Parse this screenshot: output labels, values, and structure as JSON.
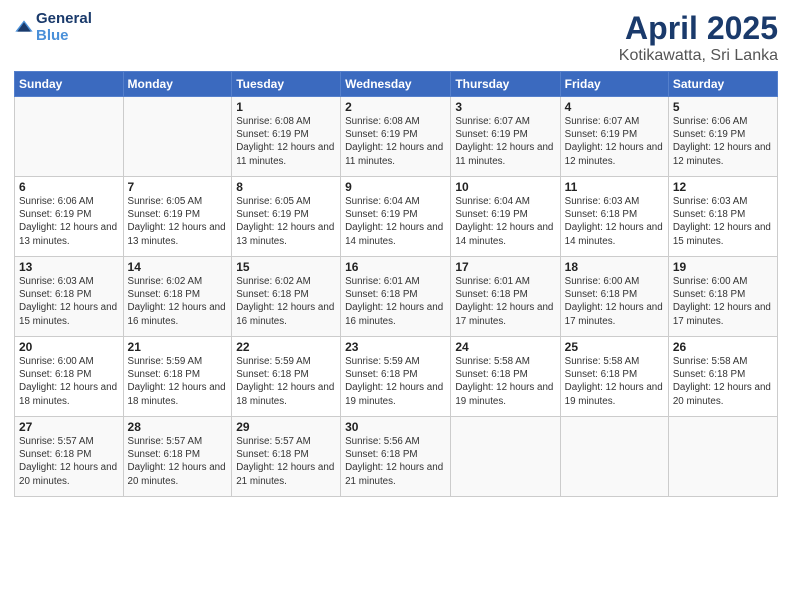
{
  "logo": {
    "text_general": "General",
    "text_blue": "Blue"
  },
  "title": "April 2025",
  "subtitle": "Kotikawatta, Sri Lanka",
  "days_of_week": [
    "Sunday",
    "Monday",
    "Tuesday",
    "Wednesday",
    "Thursday",
    "Friday",
    "Saturday"
  ],
  "weeks": [
    [
      {
        "day": "",
        "info": ""
      },
      {
        "day": "",
        "info": ""
      },
      {
        "day": "1",
        "info": "Sunrise: 6:08 AM\nSunset: 6:19 PM\nDaylight: 12 hours and 11 minutes."
      },
      {
        "day": "2",
        "info": "Sunrise: 6:08 AM\nSunset: 6:19 PM\nDaylight: 12 hours and 11 minutes."
      },
      {
        "day": "3",
        "info": "Sunrise: 6:07 AM\nSunset: 6:19 PM\nDaylight: 12 hours and 11 minutes."
      },
      {
        "day": "4",
        "info": "Sunrise: 6:07 AM\nSunset: 6:19 PM\nDaylight: 12 hours and 12 minutes."
      },
      {
        "day": "5",
        "info": "Sunrise: 6:06 AM\nSunset: 6:19 PM\nDaylight: 12 hours and 12 minutes."
      }
    ],
    [
      {
        "day": "6",
        "info": "Sunrise: 6:06 AM\nSunset: 6:19 PM\nDaylight: 12 hours and 13 minutes."
      },
      {
        "day": "7",
        "info": "Sunrise: 6:05 AM\nSunset: 6:19 PM\nDaylight: 12 hours and 13 minutes."
      },
      {
        "day": "8",
        "info": "Sunrise: 6:05 AM\nSunset: 6:19 PM\nDaylight: 12 hours and 13 minutes."
      },
      {
        "day": "9",
        "info": "Sunrise: 6:04 AM\nSunset: 6:19 PM\nDaylight: 12 hours and 14 minutes."
      },
      {
        "day": "10",
        "info": "Sunrise: 6:04 AM\nSunset: 6:19 PM\nDaylight: 12 hours and 14 minutes."
      },
      {
        "day": "11",
        "info": "Sunrise: 6:03 AM\nSunset: 6:18 PM\nDaylight: 12 hours and 14 minutes."
      },
      {
        "day": "12",
        "info": "Sunrise: 6:03 AM\nSunset: 6:18 PM\nDaylight: 12 hours and 15 minutes."
      }
    ],
    [
      {
        "day": "13",
        "info": "Sunrise: 6:03 AM\nSunset: 6:18 PM\nDaylight: 12 hours and 15 minutes."
      },
      {
        "day": "14",
        "info": "Sunrise: 6:02 AM\nSunset: 6:18 PM\nDaylight: 12 hours and 16 minutes."
      },
      {
        "day": "15",
        "info": "Sunrise: 6:02 AM\nSunset: 6:18 PM\nDaylight: 12 hours and 16 minutes."
      },
      {
        "day": "16",
        "info": "Sunrise: 6:01 AM\nSunset: 6:18 PM\nDaylight: 12 hours and 16 minutes."
      },
      {
        "day": "17",
        "info": "Sunrise: 6:01 AM\nSunset: 6:18 PM\nDaylight: 12 hours and 17 minutes."
      },
      {
        "day": "18",
        "info": "Sunrise: 6:00 AM\nSunset: 6:18 PM\nDaylight: 12 hours and 17 minutes."
      },
      {
        "day": "19",
        "info": "Sunrise: 6:00 AM\nSunset: 6:18 PM\nDaylight: 12 hours and 17 minutes."
      }
    ],
    [
      {
        "day": "20",
        "info": "Sunrise: 6:00 AM\nSunset: 6:18 PM\nDaylight: 12 hours and 18 minutes."
      },
      {
        "day": "21",
        "info": "Sunrise: 5:59 AM\nSunset: 6:18 PM\nDaylight: 12 hours and 18 minutes."
      },
      {
        "day": "22",
        "info": "Sunrise: 5:59 AM\nSunset: 6:18 PM\nDaylight: 12 hours and 18 minutes."
      },
      {
        "day": "23",
        "info": "Sunrise: 5:59 AM\nSunset: 6:18 PM\nDaylight: 12 hours and 19 minutes."
      },
      {
        "day": "24",
        "info": "Sunrise: 5:58 AM\nSunset: 6:18 PM\nDaylight: 12 hours and 19 minutes."
      },
      {
        "day": "25",
        "info": "Sunrise: 5:58 AM\nSunset: 6:18 PM\nDaylight: 12 hours and 19 minutes."
      },
      {
        "day": "26",
        "info": "Sunrise: 5:58 AM\nSunset: 6:18 PM\nDaylight: 12 hours and 20 minutes."
      }
    ],
    [
      {
        "day": "27",
        "info": "Sunrise: 5:57 AM\nSunset: 6:18 PM\nDaylight: 12 hours and 20 minutes."
      },
      {
        "day": "28",
        "info": "Sunrise: 5:57 AM\nSunset: 6:18 PM\nDaylight: 12 hours and 20 minutes."
      },
      {
        "day": "29",
        "info": "Sunrise: 5:57 AM\nSunset: 6:18 PM\nDaylight: 12 hours and 21 minutes."
      },
      {
        "day": "30",
        "info": "Sunrise: 5:56 AM\nSunset: 6:18 PM\nDaylight: 12 hours and 21 minutes."
      },
      {
        "day": "",
        "info": ""
      },
      {
        "day": "",
        "info": ""
      },
      {
        "day": "",
        "info": ""
      }
    ]
  ]
}
